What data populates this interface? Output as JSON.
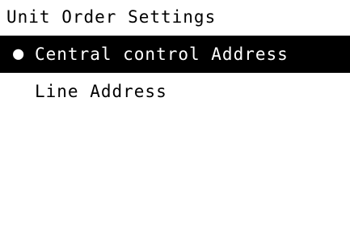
{
  "screen": {
    "title": "Unit Order Settings"
  },
  "menu": {
    "items": [
      {
        "label": "Central control Address",
        "marker": "●",
        "selected": true
      },
      {
        "label": "Line Address",
        "marker": "",
        "selected": false
      }
    ]
  },
  "colors": {
    "background": "#ffffff",
    "text": "#000000",
    "selected_background": "#000000",
    "selected_text": "#ffffff"
  }
}
